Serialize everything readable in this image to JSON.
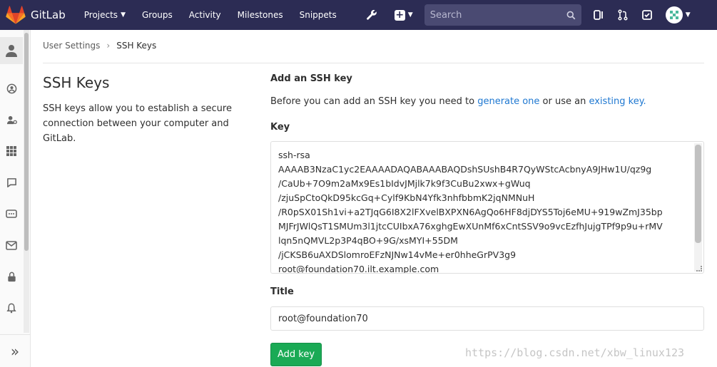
{
  "topnav": {
    "brand": "GitLab",
    "links": [
      {
        "label": "Projects",
        "caret": true
      },
      {
        "label": "Groups"
      },
      {
        "label": "Activity"
      },
      {
        "label": "Milestones"
      },
      {
        "label": "Snippets"
      }
    ],
    "search_placeholder": "Search",
    "colors": {
      "background": "#2c2c54",
      "search": "#4a4a72"
    }
  },
  "sidebar": {
    "items": [
      "profile-icon",
      "account-icon",
      "applications-icon",
      "chat-icon",
      "access-tokens-icon",
      "emails-icon",
      "password-icon",
      "notifications-icon"
    ],
    "active": "profile-icon",
    "collapse_glyph": "»"
  },
  "breadcrumb": {
    "parent": "User Settings",
    "separator": "›",
    "current": "SSH Keys"
  },
  "left": {
    "title": "SSH Keys",
    "description": "SSH keys allow you to establish a secure connection between your computer and GitLab."
  },
  "form": {
    "section_title": "Add an SSH key",
    "intro_before": "Before you can add an SSH key you need to ",
    "intro_link1": "generate one",
    "intro_middle": " or use an ",
    "intro_link2": "existing key.",
    "key_label": "Key",
    "key_value": "ssh-rsa\nAAAAB3NzaC1yc2EAAAADAQABAAABAQDshSUshB4R7QyWStcAcbnyA9JHw1U/qz9g\n/CaUb+7O9m2aMx9Es1bIdvJMjlk7k9f3CuBu2xwx+gWuq\n/zjuSpCtoQkD95kcGq+Cylf9KbN4Yfk3nhfbbmK2jqNMNuH\n/R0pSX01Sh1vi+a2TJqG6I8X2lFXvelBXPXN6AgQo6HF8djDYS5Toj6eMU+919wZmJ35bp\nMJFrJWlQsT1SMUm3l1jtcCUIbxA76xghgEwXUnMf6xCntSSV9o9vcEzfhJujgTPf9p9u+rMV\nlqn5nQMVL2p3P4qBO+9G/xsMYI+55DM\n/jCKSB6uAXDSlomroEFzNJNw14vMe+er0hheGrPV3g9\nroot@foundation70.ilt.example.com",
    "title_label": "Title",
    "title_value": "root@foundation70",
    "submit_label": "Add key",
    "colors": {
      "link": "#1f78d1",
      "submit": "#1aaa55"
    }
  },
  "watermark": "https://blog.csdn.net/xbw_linux123"
}
